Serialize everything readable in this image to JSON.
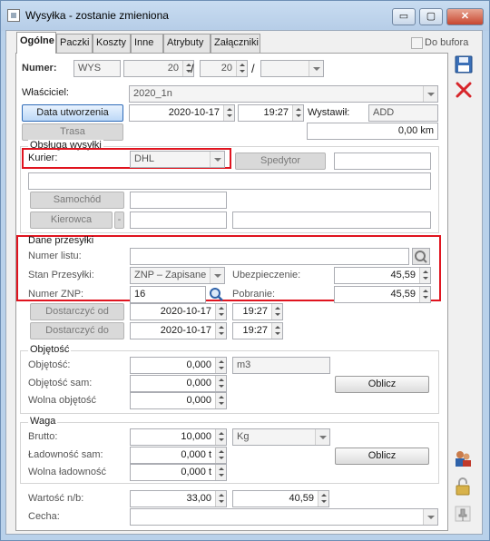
{
  "window": {
    "title": "Wysyłka - zostanie zmieniona",
    "min_label": "▭",
    "max_label": "▢",
    "close_label": "✕"
  },
  "tabs": [
    "Ogólne",
    "Paczki",
    "Koszty",
    "Inne",
    "Atrybuty",
    "Załączniki"
  ],
  "do_bufora": "Do bufora",
  "numer": {
    "label": "Numer:",
    "prefix": "WYS",
    "num": "20",
    "num2": "20",
    "slash1": "/",
    "slash2": "/"
  },
  "wlasciciel": {
    "label": "Właściciel:",
    "value": "2020_1n"
  },
  "data_utworzenia": {
    "button": "Data utworzenia",
    "date": "2020-10-17",
    "time": "19:27",
    "wystawil_label": "Wystawił:",
    "wystawil": "ADD"
  },
  "trasa": {
    "button": "Trasa",
    "distance": "0,00 km"
  },
  "obsluga": {
    "title": "Obsługa wysyłki",
    "kurier_label": "Kurier:",
    "kurier": "DHL",
    "spedytor_button": "Spedytor",
    "samochod_button": "Samochód",
    "kierowca_button": "Kierowca",
    "kierowca_dash": "-"
  },
  "dane": {
    "title": "Dane przesyłki",
    "numer_listu_label": "Numer listu:",
    "stan_label": "Stan Przesyłki:",
    "stan": "ZNP – Zapisane",
    "ubezp_label": "Ubezpieczenie:",
    "ubezp": "45,59",
    "numer_znp_label": "Numer ZNP:",
    "numer_znp": "16",
    "pobranie_label": "Pobranie:",
    "pobranie": "45,59"
  },
  "dostarczyc": {
    "od_button": "Dostarczyć od",
    "do_button": "Dostarczyć do",
    "od_date": "2020-10-17",
    "od_time": "19:27",
    "do_date": "2020-10-17",
    "do_time": "19:27"
  },
  "objetosc": {
    "title": "Objętość",
    "obj_label": "Objętość:",
    "obj": "0,000",
    "unit": "m3",
    "obj_sam_label": "Objętość sam:",
    "obj_sam": "0,000",
    "wolna_label": "Wolna objętość",
    "wolna": "0,000",
    "oblicz": "Oblicz"
  },
  "waga": {
    "title": "Waga",
    "brutto_label": "Brutto:",
    "brutto": "10,000",
    "unit": "Kg",
    "ladownosc_label": "Ładowność sam:",
    "ladownosc": "0,000 t",
    "wolna_label": "Wolna ładowność",
    "wolna": "0,000 t",
    "oblicz": "Oblicz"
  },
  "wartosc": {
    "label": "Wartość n/b:",
    "value1": "33,00",
    "value2": "40,59"
  },
  "cecha": {
    "label": "Cecha:",
    "value": ""
  }
}
